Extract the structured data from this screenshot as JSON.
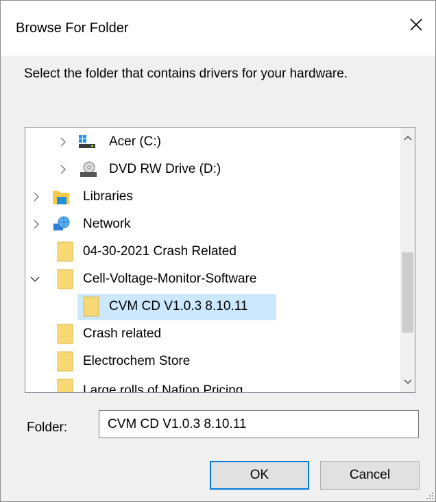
{
  "window": {
    "title": "Browse For Folder",
    "close_icon": "close-icon"
  },
  "instructions": "Select the folder that contains drivers for your hardware.",
  "tree": {
    "items": [
      {
        "label": "Acer (C:)",
        "icon": "drive-icon",
        "expander": "collapsed"
      },
      {
        "label": "DVD RW Drive (D:)",
        "icon": "dvd-drive-icon",
        "expander": "collapsed"
      },
      {
        "label": "Libraries",
        "icon": "libraries-icon",
        "expander": "collapsed"
      },
      {
        "label": "Network",
        "icon": "network-icon",
        "expander": "collapsed"
      },
      {
        "label": "04-30-2021 Crash Related",
        "icon": "folder-icon",
        "expander": "none"
      },
      {
        "label": "Cell-Voltage-Monitor-Software",
        "icon": "folder-icon",
        "expander": "expanded"
      },
      {
        "label": "CVM CD V1.0.3 8.10.11",
        "icon": "folder-icon",
        "expander": "none",
        "selected": true
      },
      {
        "label": "Crash related",
        "icon": "folder-icon",
        "expander": "none"
      },
      {
        "label": "Electrochem Store",
        "icon": "folder-icon",
        "expander": "none"
      },
      {
        "label": "Large rolls of Nafion Pricing",
        "icon": "folder-icon",
        "expander": "none"
      }
    ]
  },
  "folder": {
    "label": "Folder:",
    "value": "CVM CD V1.0.3 8.10.11"
  },
  "buttons": {
    "ok": "OK",
    "cancel": "Cancel"
  },
  "colors": {
    "selection": "#cce8ff",
    "folder": "#f8d775",
    "accent": "#0078d7"
  }
}
